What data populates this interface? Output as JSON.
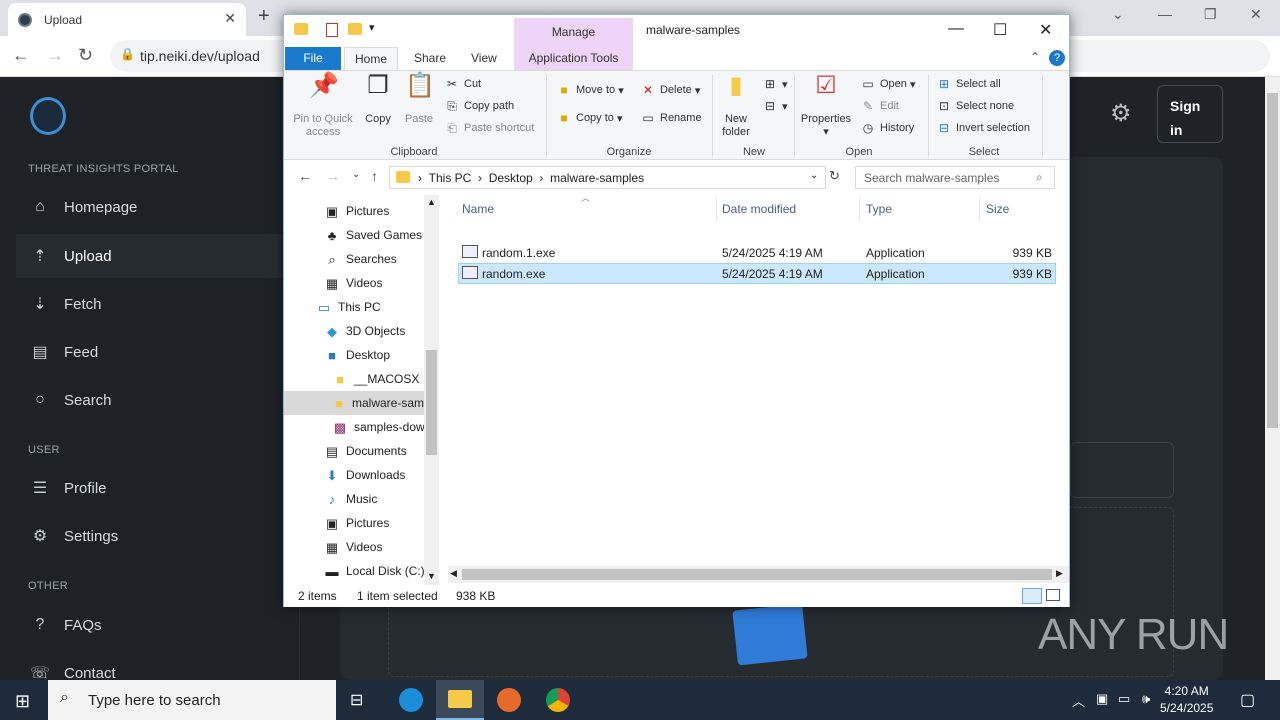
{
  "browser": {
    "tab_title": "Upload",
    "url": "tip.neiki.dev/upload"
  },
  "site": {
    "portal_label": "THREAT INSIGHTS PORTAL",
    "nav_main": [
      {
        "label": "Homepage",
        "icon": "home-icon"
      },
      {
        "label": "Upload",
        "icon": "upload-icon"
      },
      {
        "label": "Fetch",
        "icon": "fetch-icon"
      },
      {
        "label": "Feed",
        "icon": "feed-icon"
      },
      {
        "label": "Search",
        "icon": "search-icon"
      }
    ],
    "user_label": "USER",
    "nav_user": [
      {
        "label": "Profile",
        "icon": "profile-icon"
      },
      {
        "label": "Settings",
        "icon": "gear-icon"
      }
    ],
    "other_label": "OTHER",
    "nav_other": [
      {
        "label": "FAQs",
        "icon": "faq-icon"
      },
      {
        "label": "Contact",
        "icon": "contact-icon"
      }
    ],
    "signin": "Sign in",
    "watermark": "ANY RUN"
  },
  "explorer": {
    "manage": "Manage",
    "title": "malware-samples",
    "tabs": {
      "file": "File",
      "home": "Home",
      "share": "Share",
      "view": "View",
      "apptools": "Application Tools"
    },
    "clipboard": {
      "pin": "Pin to Quick access",
      "copy": "Copy",
      "paste": "Paste",
      "cut": "Cut",
      "copy_path": "Copy path",
      "paste_shortcut": "Paste shortcut",
      "group": "Clipboard"
    },
    "organize": {
      "move_to": "Move to",
      "copy_to": "Copy to",
      "delete": "Delete",
      "rename": "Rename",
      "group": "Organize"
    },
    "new": {
      "new_folder": "New folder",
      "group": "New"
    },
    "open": {
      "properties": "Properties",
      "open": "Open",
      "edit": "Edit",
      "history": "History",
      "group": "Open"
    },
    "select": {
      "all": "Select all",
      "none": "Select none",
      "invert": "Invert selection",
      "group": "Select"
    },
    "path": [
      "This PC",
      "Desktop",
      "malware-samples"
    ],
    "search_placeholder": "Search malware-samples",
    "tree": [
      "Pictures",
      "Saved Games",
      "Searches",
      "Videos",
      "This PC",
      "3D Objects",
      "Desktop",
      "__MACOSX",
      "malware-sam",
      "samples-dow",
      "Documents",
      "Downloads",
      "Music",
      "Pictures",
      "Videos",
      "Local Disk (C:)"
    ],
    "columns": {
      "name": "Name",
      "date": "Date modified",
      "type": "Type",
      "size": "Size"
    },
    "files": [
      {
        "name": "random.1.exe",
        "date": "5/24/2025 4:19 AM",
        "type": "Application",
        "size": "939 KB"
      },
      {
        "name": "random.exe",
        "date": "5/24/2025 4:19 AM",
        "type": "Application",
        "size": "939 KB"
      }
    ],
    "status": {
      "items": "2 items",
      "selected": "1 item selected",
      "size": "938 KB"
    }
  },
  "taskbar": {
    "search_placeholder": "Type here to search",
    "time": "4:20 AM",
    "date": "5/24/2025"
  }
}
